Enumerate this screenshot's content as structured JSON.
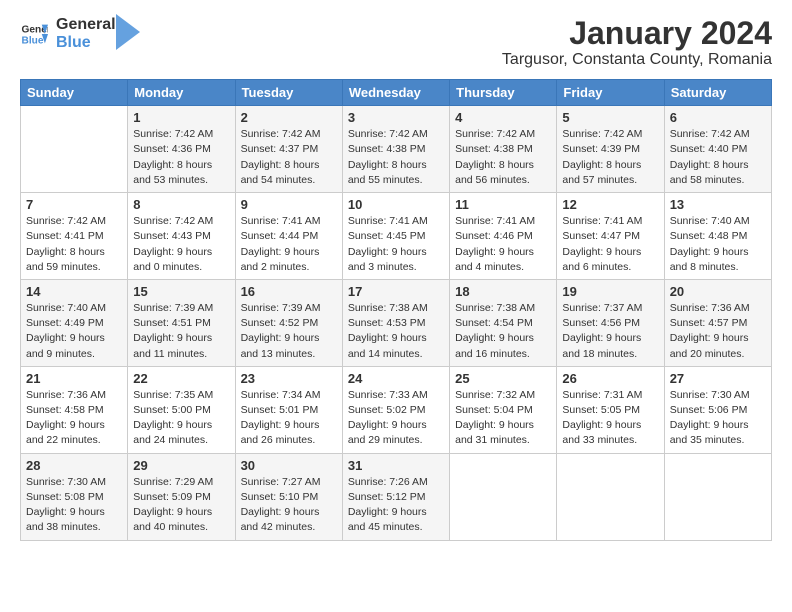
{
  "header": {
    "logo_line1": "General",
    "logo_line2": "Blue",
    "title": "January 2024",
    "subtitle": "Targusor, Constanta County, Romania"
  },
  "weekdays": [
    "Sunday",
    "Monday",
    "Tuesday",
    "Wednesday",
    "Thursday",
    "Friday",
    "Saturday"
  ],
  "weeks": [
    [
      {
        "day": "",
        "sunrise": "",
        "sunset": "",
        "daylight": ""
      },
      {
        "day": "1",
        "sunrise": "Sunrise: 7:42 AM",
        "sunset": "Sunset: 4:36 PM",
        "daylight": "Daylight: 8 hours and 53 minutes."
      },
      {
        "day": "2",
        "sunrise": "Sunrise: 7:42 AM",
        "sunset": "Sunset: 4:37 PM",
        "daylight": "Daylight: 8 hours and 54 minutes."
      },
      {
        "day": "3",
        "sunrise": "Sunrise: 7:42 AM",
        "sunset": "Sunset: 4:38 PM",
        "daylight": "Daylight: 8 hours and 55 minutes."
      },
      {
        "day": "4",
        "sunrise": "Sunrise: 7:42 AM",
        "sunset": "Sunset: 4:38 PM",
        "daylight": "Daylight: 8 hours and 56 minutes."
      },
      {
        "day": "5",
        "sunrise": "Sunrise: 7:42 AM",
        "sunset": "Sunset: 4:39 PM",
        "daylight": "Daylight: 8 hours and 57 minutes."
      },
      {
        "day": "6",
        "sunrise": "Sunrise: 7:42 AM",
        "sunset": "Sunset: 4:40 PM",
        "daylight": "Daylight: 8 hours and 58 minutes."
      }
    ],
    [
      {
        "day": "7",
        "sunrise": "Sunrise: 7:42 AM",
        "sunset": "Sunset: 4:41 PM",
        "daylight": "Daylight: 8 hours and 59 minutes."
      },
      {
        "day": "8",
        "sunrise": "Sunrise: 7:42 AM",
        "sunset": "Sunset: 4:43 PM",
        "daylight": "Daylight: 9 hours and 0 minutes."
      },
      {
        "day": "9",
        "sunrise": "Sunrise: 7:41 AM",
        "sunset": "Sunset: 4:44 PM",
        "daylight": "Daylight: 9 hours and 2 minutes."
      },
      {
        "day": "10",
        "sunrise": "Sunrise: 7:41 AM",
        "sunset": "Sunset: 4:45 PM",
        "daylight": "Daylight: 9 hours and 3 minutes."
      },
      {
        "day": "11",
        "sunrise": "Sunrise: 7:41 AM",
        "sunset": "Sunset: 4:46 PM",
        "daylight": "Daylight: 9 hours and 4 minutes."
      },
      {
        "day": "12",
        "sunrise": "Sunrise: 7:41 AM",
        "sunset": "Sunset: 4:47 PM",
        "daylight": "Daylight: 9 hours and 6 minutes."
      },
      {
        "day": "13",
        "sunrise": "Sunrise: 7:40 AM",
        "sunset": "Sunset: 4:48 PM",
        "daylight": "Daylight: 9 hours and 8 minutes."
      }
    ],
    [
      {
        "day": "14",
        "sunrise": "Sunrise: 7:40 AM",
        "sunset": "Sunset: 4:49 PM",
        "daylight": "Daylight: 9 hours and 9 minutes."
      },
      {
        "day": "15",
        "sunrise": "Sunrise: 7:39 AM",
        "sunset": "Sunset: 4:51 PM",
        "daylight": "Daylight: 9 hours and 11 minutes."
      },
      {
        "day": "16",
        "sunrise": "Sunrise: 7:39 AM",
        "sunset": "Sunset: 4:52 PM",
        "daylight": "Daylight: 9 hours and 13 minutes."
      },
      {
        "day": "17",
        "sunrise": "Sunrise: 7:38 AM",
        "sunset": "Sunset: 4:53 PM",
        "daylight": "Daylight: 9 hours and 14 minutes."
      },
      {
        "day": "18",
        "sunrise": "Sunrise: 7:38 AM",
        "sunset": "Sunset: 4:54 PM",
        "daylight": "Daylight: 9 hours and 16 minutes."
      },
      {
        "day": "19",
        "sunrise": "Sunrise: 7:37 AM",
        "sunset": "Sunset: 4:56 PM",
        "daylight": "Daylight: 9 hours and 18 minutes."
      },
      {
        "day": "20",
        "sunrise": "Sunrise: 7:36 AM",
        "sunset": "Sunset: 4:57 PM",
        "daylight": "Daylight: 9 hours and 20 minutes."
      }
    ],
    [
      {
        "day": "21",
        "sunrise": "Sunrise: 7:36 AM",
        "sunset": "Sunset: 4:58 PM",
        "daylight": "Daylight: 9 hours and 22 minutes."
      },
      {
        "day": "22",
        "sunrise": "Sunrise: 7:35 AM",
        "sunset": "Sunset: 5:00 PM",
        "daylight": "Daylight: 9 hours and 24 minutes."
      },
      {
        "day": "23",
        "sunrise": "Sunrise: 7:34 AM",
        "sunset": "Sunset: 5:01 PM",
        "daylight": "Daylight: 9 hours and 26 minutes."
      },
      {
        "day": "24",
        "sunrise": "Sunrise: 7:33 AM",
        "sunset": "Sunset: 5:02 PM",
        "daylight": "Daylight: 9 hours and 29 minutes."
      },
      {
        "day": "25",
        "sunrise": "Sunrise: 7:32 AM",
        "sunset": "Sunset: 5:04 PM",
        "daylight": "Daylight: 9 hours and 31 minutes."
      },
      {
        "day": "26",
        "sunrise": "Sunrise: 7:31 AM",
        "sunset": "Sunset: 5:05 PM",
        "daylight": "Daylight: 9 hours and 33 minutes."
      },
      {
        "day": "27",
        "sunrise": "Sunrise: 7:30 AM",
        "sunset": "Sunset: 5:06 PM",
        "daylight": "Daylight: 9 hours and 35 minutes."
      }
    ],
    [
      {
        "day": "28",
        "sunrise": "Sunrise: 7:30 AM",
        "sunset": "Sunset: 5:08 PM",
        "daylight": "Daylight: 9 hours and 38 minutes."
      },
      {
        "day": "29",
        "sunrise": "Sunrise: 7:29 AM",
        "sunset": "Sunset: 5:09 PM",
        "daylight": "Daylight: 9 hours and 40 minutes."
      },
      {
        "day": "30",
        "sunrise": "Sunrise: 7:27 AM",
        "sunset": "Sunset: 5:10 PM",
        "daylight": "Daylight: 9 hours and 42 minutes."
      },
      {
        "day": "31",
        "sunrise": "Sunrise: 7:26 AM",
        "sunset": "Sunset: 5:12 PM",
        "daylight": "Daylight: 9 hours and 45 minutes."
      },
      {
        "day": "",
        "sunrise": "",
        "sunset": "",
        "daylight": ""
      },
      {
        "day": "",
        "sunrise": "",
        "sunset": "",
        "daylight": ""
      },
      {
        "day": "",
        "sunrise": "",
        "sunset": "",
        "daylight": ""
      }
    ]
  ]
}
